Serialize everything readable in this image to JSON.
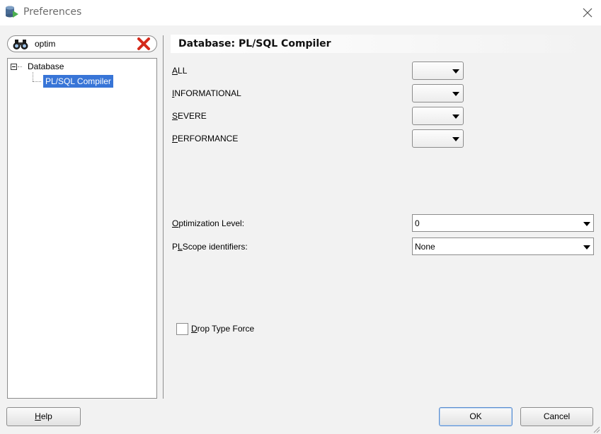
{
  "window": {
    "title": "Preferences",
    "app_icon": "database-app-icon",
    "close_icon": "close-x-icon"
  },
  "search": {
    "value": "optim",
    "icon": "binoculars-icon",
    "clear_icon": "red-x-clear-icon"
  },
  "tree": {
    "expander_icon": "minus-expander-icon",
    "items": [
      {
        "label": "Database",
        "expanded": true
      },
      {
        "label": "PL/SQL Compiler",
        "selected": true
      }
    ]
  },
  "panel": {
    "title": "Database: PL/SQL Compiler",
    "warnings": [
      {
        "mnemonic": "A",
        "rest": "LL",
        "value": ""
      },
      {
        "mnemonic": "I",
        "rest": "NFORMATIONAL",
        "value": ""
      },
      {
        "mnemonic": "S",
        "rest": "EVERE",
        "value": ""
      },
      {
        "mnemonic": "P",
        "rest": "ERFORMANCE",
        "value": ""
      }
    ],
    "optimization": {
      "mnemonic": "O",
      "rest": "ptimization Level:",
      "value": "0"
    },
    "plscope": {
      "pre": "P",
      "mnemonic": "L",
      "rest": "Scope identifiers:",
      "value": "None"
    },
    "drop_type_force": {
      "mnemonic": "D",
      "rest": "rop Type Force",
      "checked": false
    }
  },
  "buttons": {
    "help": {
      "mnemonic": "H",
      "rest": "elp"
    },
    "ok": "OK",
    "cancel": "Cancel"
  },
  "colors": {
    "selection": "#3875d7",
    "client_bg": "#f2f2f2",
    "border": "#8c8c8c"
  }
}
